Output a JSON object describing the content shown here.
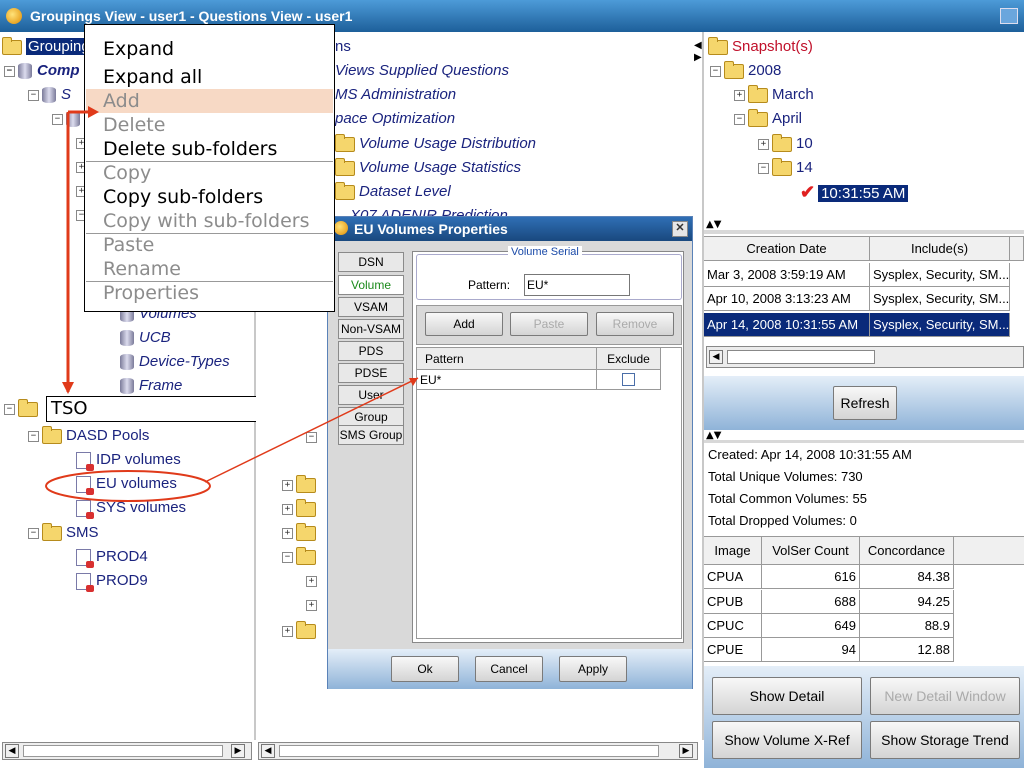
{
  "window": {
    "title": "Groupings View - user1 - Questions View - user1"
  },
  "left_tree": {
    "root": "Groupings",
    "comp": "Comp",
    "s_node": "S",
    "volumes": "Volumes",
    "ucb": "UCB",
    "device_types": "Device-Types",
    "frame": "Frame",
    "tso_label": "TSO",
    "dasd_pools": "DASD Pools",
    "idp_volumes": "IDP volumes",
    "eu_volumes": "EU volumes",
    "sys_volumes": "SYS volumes",
    "sms": "SMS",
    "prod4": "PROD4",
    "prod9": "PROD9"
  },
  "context_menu": {
    "items": [
      {
        "label": "Expand"
      },
      {
        "label": "Expand all"
      },
      {
        "label": "Add"
      },
      {
        "label": "Delete"
      },
      {
        "label": "Delete sub-folders"
      },
      {
        "label": "Copy"
      },
      {
        "label": "Copy sub-folders"
      },
      {
        "label": "Copy with sub-folders"
      },
      {
        "label": "Paste"
      },
      {
        "label": "Rename"
      },
      {
        "label": "Properties"
      }
    ]
  },
  "middle_tree": {
    "ns": "ns",
    "views_supplied": "Views Supplied Questions",
    "ms_admin": "MS Administration",
    "pace_opt": "pace Optimization",
    "vol_usage_dist": "Volume Usage Distribution",
    "vol_usage_stats": "Volume Usage Statistics",
    "dataset_level": "Dataset Level",
    "partial": "X07 ADENIR Prediction"
  },
  "dialog": {
    "title": "EU Volumes Properties",
    "tabs": [
      "DSN",
      "Volume",
      "VSAM",
      "Non-VSAM",
      "PDS",
      "PDSE",
      "User",
      "Group",
      "SMS Group"
    ],
    "group_title": "Volume Serial",
    "pattern_label": "Pattern:",
    "pattern_value": "EU*",
    "add": "Add",
    "paste": "Paste",
    "remove": "Remove",
    "col_pattern": "Pattern",
    "col_exclude": "Exclude",
    "row_pattern": "EU*",
    "ok": "Ok",
    "cancel": "Cancel",
    "apply": "Apply"
  },
  "right": {
    "snapshots": "Snapshot(s)",
    "year": "2008",
    "march": "March",
    "april": "April",
    "day10": "10",
    "day14": "14",
    "time_selected": "10:31:55 AM",
    "table1_headers": [
      "Creation Date",
      "Include(s)"
    ],
    "table1_rows": [
      [
        "Mar 3, 2008 3:59:19 AM",
        "Sysplex, Security, SM..."
      ],
      [
        "Apr 10, 2008 3:13:23 AM",
        "Sysplex, Security, SM..."
      ],
      [
        "Apr 14, 2008 10:31:55 AM",
        "Sysplex, Security, SM..."
      ]
    ],
    "refresh": "Refresh",
    "info": [
      "Created: Apr 14, 2008 10:31:55 AM",
      "Total Unique Volumes: 730",
      "Total Common Volumes: 55",
      "Total Dropped Volumes: 0"
    ],
    "table2_headers": [
      "Image",
      "VolSer Count",
      "Concordance"
    ],
    "table2_rows": [
      [
        "CPUA",
        "616",
        "84.38"
      ],
      [
        "CPUB",
        "688",
        "94.25"
      ],
      [
        "CPUC",
        "649",
        "88.9"
      ],
      [
        "CPUE",
        "94",
        "12.88"
      ]
    ],
    "show_detail": "Show Detail",
    "new_detail_window": "New Detail Window",
    "show_volume_xref": "Show Volume X-Ref",
    "show_storage_trend": "Show Storage Trend"
  },
  "colors": {
    "annotation": "#e03a1a",
    "selection": "#0a2a7a",
    "tree_text": "#1a237e"
  }
}
